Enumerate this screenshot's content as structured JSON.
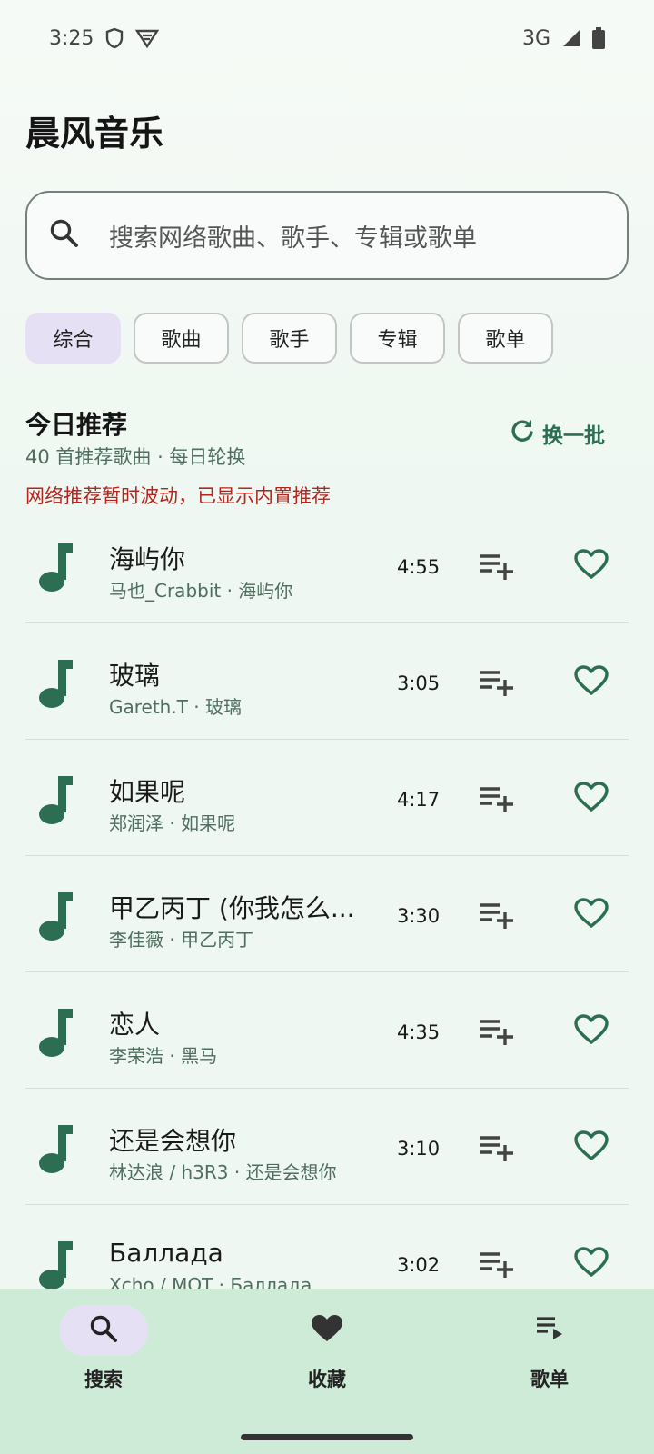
{
  "status_bar": {
    "time": "3:25",
    "network": "3G"
  },
  "app": {
    "title": "晨风音乐"
  },
  "search": {
    "placeholder": "搜索网络歌曲、歌手、专辑或歌单"
  },
  "filters": [
    {
      "label": "综合",
      "active": true
    },
    {
      "label": "歌曲",
      "active": false
    },
    {
      "label": "歌手",
      "active": false
    },
    {
      "label": "专辑",
      "active": false
    },
    {
      "label": "歌单",
      "active": false
    }
  ],
  "recommend": {
    "title": "今日推荐",
    "subtitle": "40 首推荐歌曲 · 每日轮换",
    "refresh_label": "换一批",
    "warning": "网络推荐暂时波动，已显示内置推荐"
  },
  "songs": [
    {
      "title": "海屿你",
      "subtitle": "马也_Crabbit · 海屿你",
      "duration": "4:55"
    },
    {
      "title": "玻璃",
      "subtitle": "Gareth.T · 玻璃",
      "duration": "3:05"
    },
    {
      "title": "如果呢",
      "subtitle": "郑润泽 · 如果呢",
      "duration": "4:17"
    },
    {
      "title": "甲乙丙丁 (你我怎么...",
      "subtitle": "李佳薇 · 甲乙丙丁",
      "duration": "3:30"
    },
    {
      "title": "恋人",
      "subtitle": "李荣浩 · 黑马",
      "duration": "4:35"
    },
    {
      "title": "还是会想你",
      "subtitle": "林达浪 / h3R3 · 还是会想你",
      "duration": "3:10"
    },
    {
      "title": "Баллада",
      "subtitle": "Xcho / MOT · Баллада",
      "duration": "3:02"
    }
  ],
  "bottom_nav": [
    {
      "label": "搜索",
      "icon": "search-icon",
      "active": true
    },
    {
      "label": "收藏",
      "icon": "heart-icon",
      "active": false
    },
    {
      "label": "歌单",
      "icon": "playlist-icon",
      "active": false
    }
  ],
  "colors": {
    "accent": "#2c6e51",
    "warning": "#b3261e",
    "chip_active": "#e6e0f5",
    "nav_background": "#cdebd6"
  }
}
